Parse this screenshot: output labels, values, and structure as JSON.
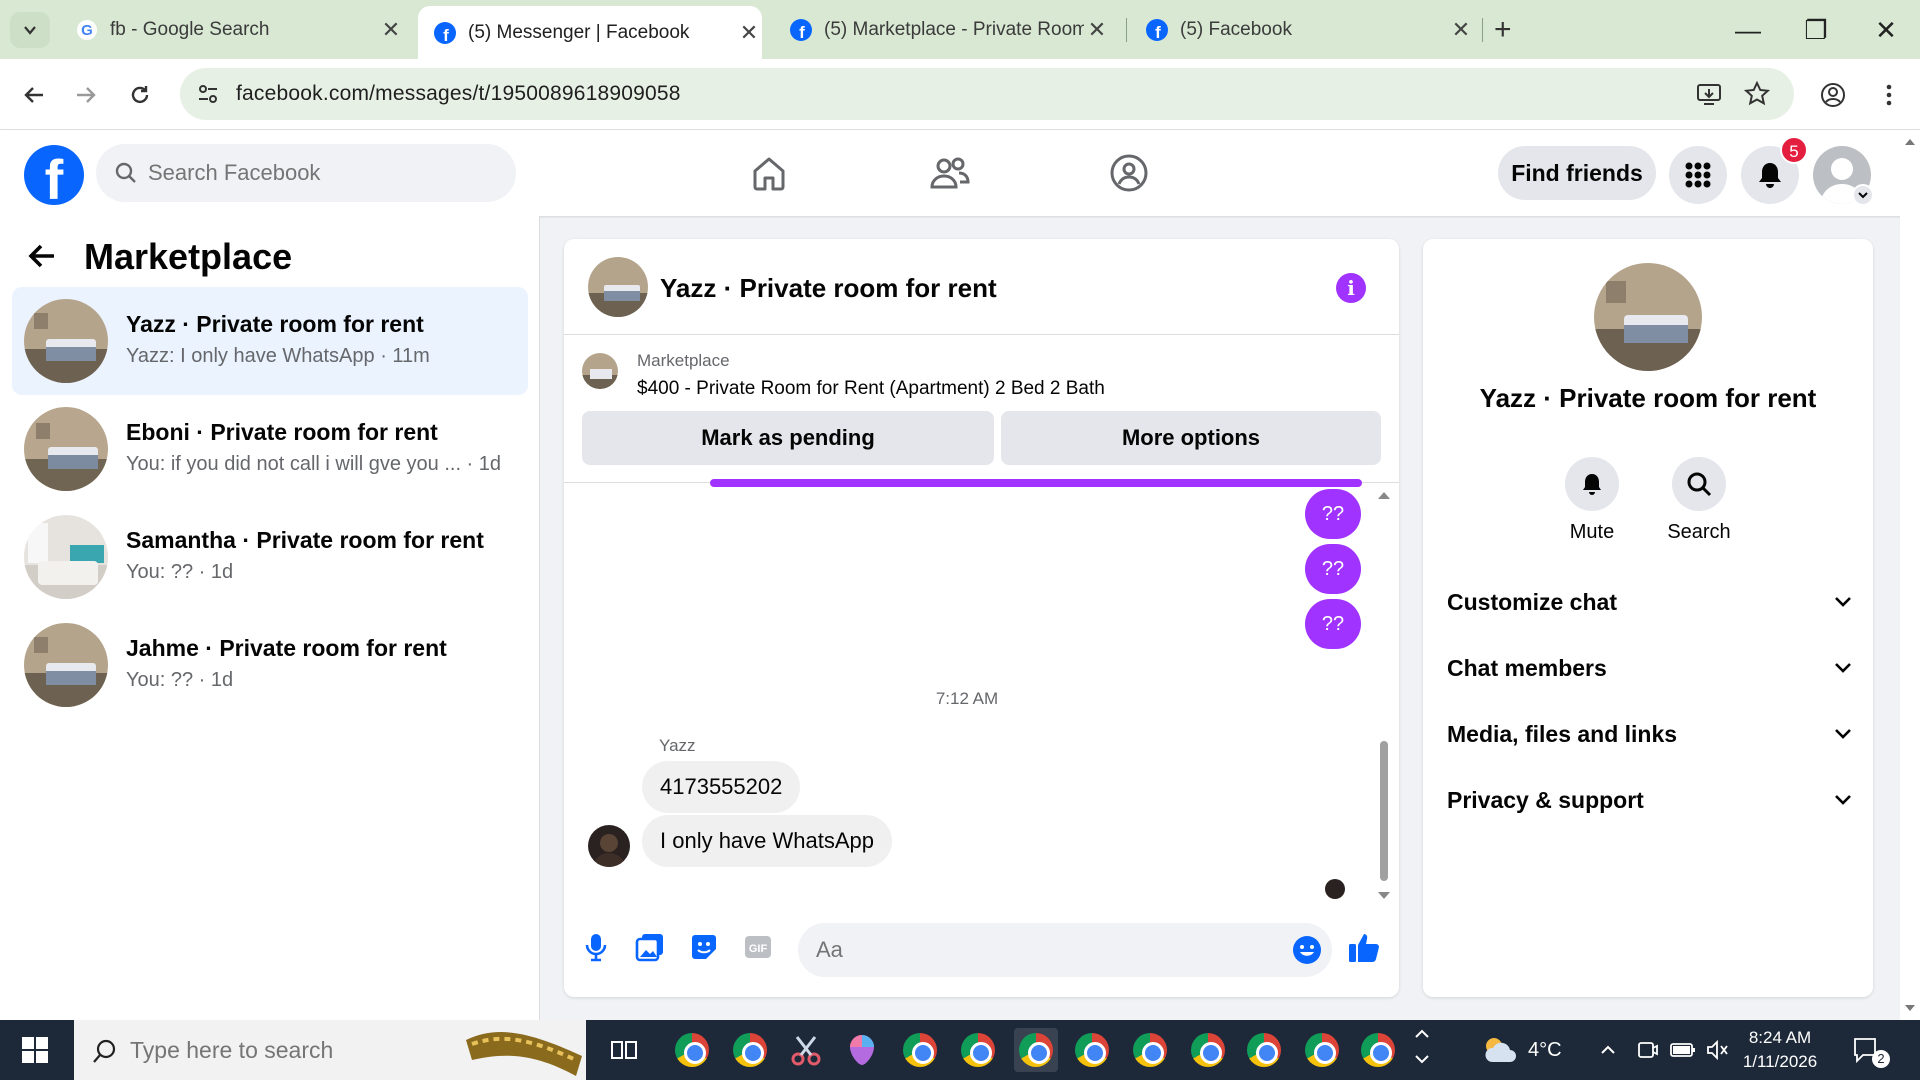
{
  "browser": {
    "tabs": [
      {
        "title": "fb - Google Search",
        "icon": "google-g-icon"
      },
      {
        "title": "(5) Messenger | Facebook",
        "icon": "facebook-icon"
      },
      {
        "title": "(5) Marketplace - Private Room",
        "icon": "facebook-icon"
      },
      {
        "title": "(5) Facebook",
        "icon": "facebook-icon"
      }
    ],
    "active_tab": 1,
    "url": "facebook.com/messages/t/1950089618909058"
  },
  "fb": {
    "search_placeholder": "Search Facebook",
    "find_friends": "Find friends",
    "notif_count": "5"
  },
  "left": {
    "title": "Marketplace",
    "conversations": [
      {
        "name": "Yazz · Private room for rent",
        "snippet": "Yazz: I only have WhatsApp · 11m",
        "selected": true
      },
      {
        "name": "Eboni · Private room for rent",
        "snippet": "You: if you did not call i will gve you ...  · 1d",
        "selected": false
      },
      {
        "name": "Samantha · Private room for rent",
        "snippet": "You: ?? · 1d",
        "selected": false
      },
      {
        "name": "Jahme · Private room for rent",
        "snippet": "You: ?? · 1d",
        "selected": false
      }
    ]
  },
  "chat": {
    "title": "Yazz · Private room for rent",
    "listing_source": "Marketplace",
    "listing_title": "$400 - Private Room for Rent (Apartment) 2 Bed 2 Bath",
    "mark_pending": "Mark as pending",
    "more_options": "More options",
    "outgoing": [
      "??",
      "??",
      "??"
    ],
    "timestamp": "7:12 AM",
    "sender": "Yazz",
    "incoming": [
      "4173555202",
      "I only have WhatsApp"
    ],
    "composer_placeholder": "Aa"
  },
  "right": {
    "name": "Yazz · Private room for rent",
    "actions": [
      "Mute",
      "Search"
    ],
    "sections": [
      "Customize chat",
      "Chat members",
      "Media, files and links",
      "Privacy & support"
    ]
  },
  "taskbar": {
    "search_placeholder": "Type here to search",
    "weather": "4°C",
    "time": "8:24 AM",
    "date": "1/11/2026",
    "notifications": "2"
  },
  "colors": {
    "accent": "#0866ff",
    "messenger_purple": "#a033ff",
    "selected_bg": "#ebf3fe"
  }
}
